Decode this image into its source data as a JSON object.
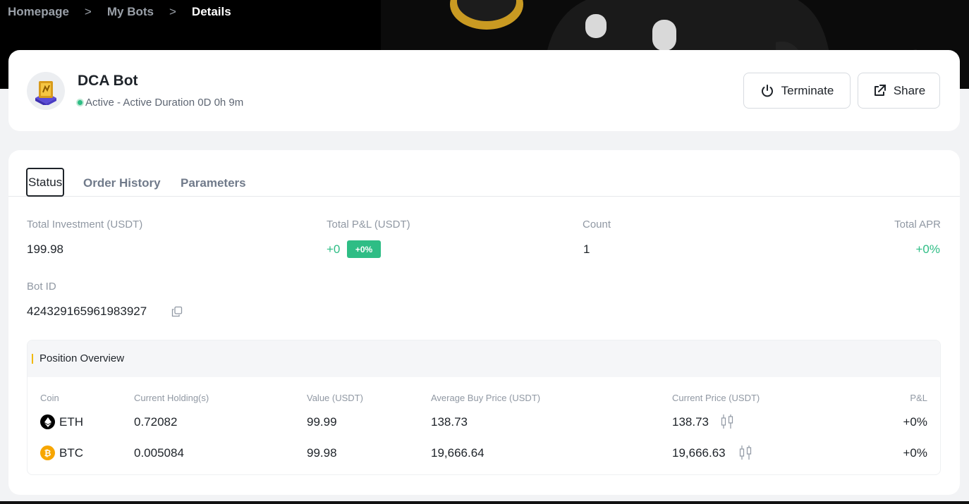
{
  "breadcrumb": {
    "home": "Homepage",
    "bots": "My Bots",
    "current": "Details",
    "separator": ">"
  },
  "bot": {
    "name": "DCA Bot",
    "status_text": "Active - Active Duration 0D 0h 9m",
    "status_color": "#2ebd85"
  },
  "actions": {
    "terminate_label": "Terminate",
    "terminate_icon": "power-icon",
    "share_label": "Share",
    "share_icon": "external-link-icon"
  },
  "tabs": [
    {
      "label": "Status",
      "active": true
    },
    {
      "label": "Order History",
      "active": false
    },
    {
      "label": "Parameters",
      "active": false
    }
  ],
  "metrics": {
    "investment_label": "Total Investment (USDT)",
    "investment_value": "199.98",
    "pnl_label": "Total P&L (USDT)",
    "pnl_value": "+0",
    "pnl_badge": "+0%",
    "count_label": "Count",
    "count_value": "1",
    "apr_label": "Total APR",
    "apr_value": "+0%",
    "bot_id_label": "Bot ID",
    "bot_id_value": "424329165961983927"
  },
  "position": {
    "title": "Position Overview",
    "accent": "#f0b90b",
    "columns": [
      "Coin",
      "Current Holding(s)",
      "Value (USDT)",
      "Average Buy Price (USDT)",
      "Current Price (USDT)",
      "P&L"
    ],
    "rows": [
      {
        "coin": "ETH",
        "holding": "0.72082",
        "value": "99.99",
        "avg_price": "138.73",
        "current_price": "138.73",
        "pnl": "+0%",
        "icon": "eth-icon",
        "icon_color": "#000000"
      },
      {
        "coin": "BTC",
        "holding": "0.005084",
        "value": "99.98",
        "avg_price": "19,666.64",
        "current_price": "19,666.63",
        "pnl": "+0%",
        "icon": "btc-icon",
        "icon_color": "#f7a600"
      }
    ]
  },
  "colors": {
    "positive": "#2ebd85",
    "hero_bg": "#000000"
  }
}
